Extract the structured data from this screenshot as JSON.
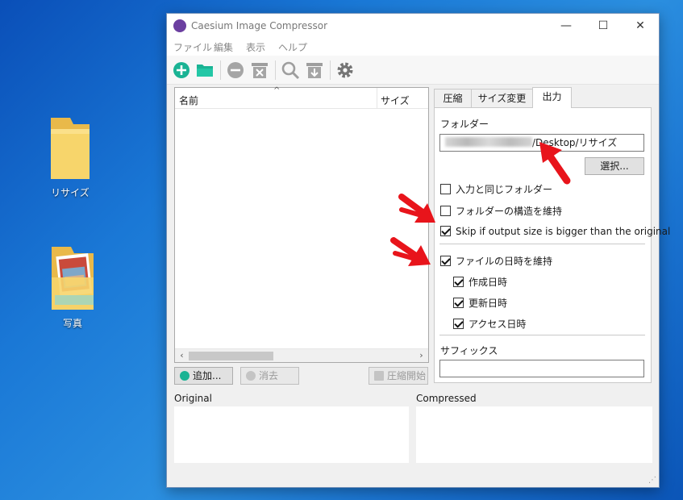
{
  "desktop": {
    "icons": [
      {
        "label": "リサイズ",
        "icon": "folder-icon"
      },
      {
        "label": "写真",
        "icon": "photo-folder-icon"
      }
    ]
  },
  "window": {
    "title": "Caesium Image Compressor",
    "controls": {
      "minimize": "—",
      "maximize": "☐",
      "close": "✕"
    }
  },
  "menu": [
    "ファイル",
    "編集",
    "表示",
    "ヘルプ"
  ],
  "toolbar": {
    "buttons": [
      "add-icon",
      "open-folder-icon",
      "remove-icon",
      "clear-icon",
      "search-icon",
      "compress-icon",
      "settings-icon"
    ],
    "colors": {
      "green": "#1ab394",
      "gray": "#9e9e9e"
    }
  },
  "file_list": {
    "columns": [
      "名前",
      "サイズ"
    ],
    "rows": []
  },
  "buttons": {
    "add": "追加...",
    "remove": "消去",
    "compress": "圧縮開始",
    "browse": "選択..."
  },
  "tabs": [
    "圧縮",
    "サイズ変更",
    "出力"
  ],
  "active_tab": "出力",
  "output": {
    "folder_label": "フォルダー",
    "folder_path_visible": "/Desktop/リサイズ",
    "options": [
      {
        "label": "入力と同じフォルダー",
        "checked": false
      },
      {
        "label": "フォルダーの構造を維持",
        "checked": false
      },
      {
        "label": "Skip if output size is bigger than the original",
        "checked": true
      },
      {
        "label": "ファイルの日時を維持",
        "checked": true
      },
      {
        "label": "作成日時",
        "checked": true
      },
      {
        "label": "更新日時",
        "checked": true
      },
      {
        "label": "アクセス日時",
        "checked": true
      }
    ],
    "suffix_label": "サフィックス",
    "suffix_value": ""
  },
  "preview": {
    "original_label": "Original",
    "compressed_label": "Compressed"
  },
  "annotation_color": "#e8141b"
}
